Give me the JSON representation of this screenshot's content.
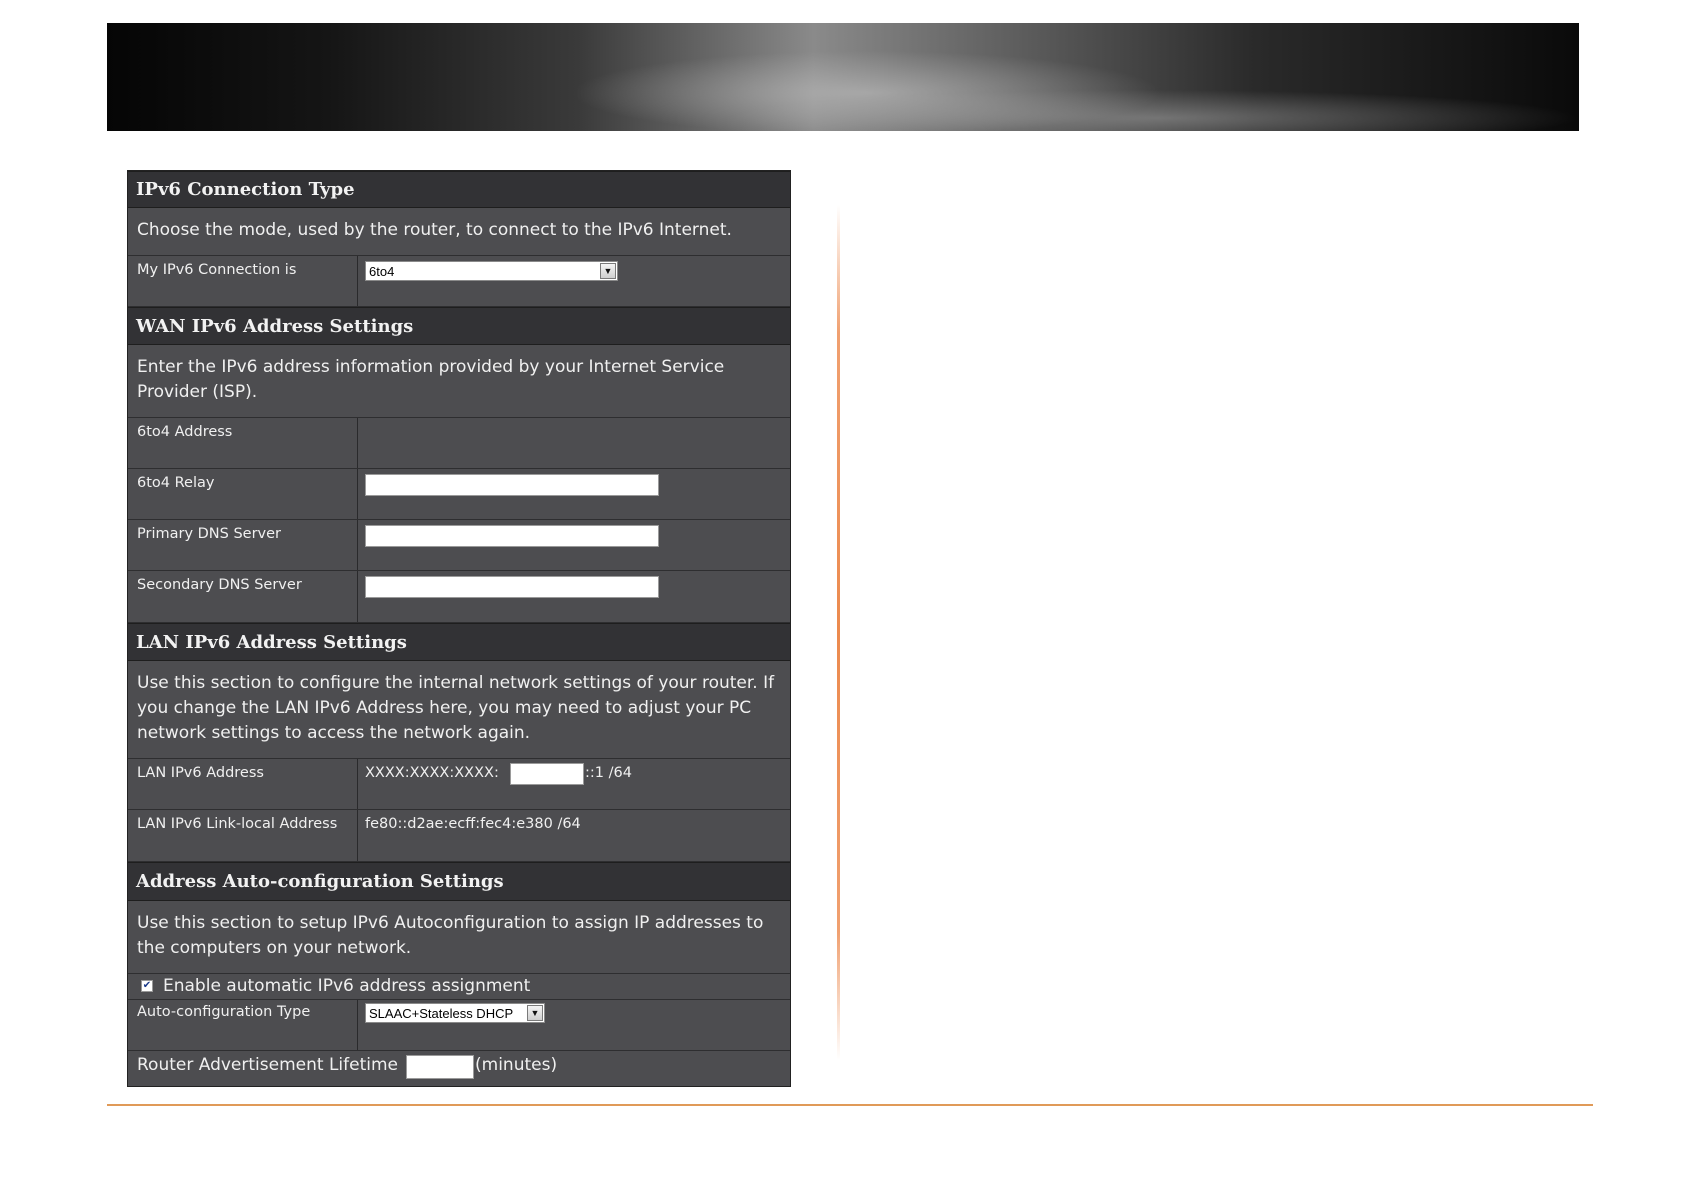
{
  "sections": {
    "connection_type": {
      "title": "IPv6 Connection Type",
      "description": "Choose the mode, used by the router, to connect to the IPv6 Internet.",
      "connection_label": "My IPv6 Connection is",
      "connection_value": "6to4"
    },
    "wan": {
      "title": "WAN IPv6 Address Settings",
      "description": "Enter the IPv6 address information provided by your Internet Service Provider (ISP).",
      "address_label": "6to4 Address",
      "relay_label": "6to4 Relay",
      "primary_dns_label": "Primary DNS Server",
      "secondary_dns_label": "Secondary DNS Server"
    },
    "lan": {
      "title": "LAN IPv6 Address Settings",
      "description": "Use this section to configure the internal network settings of your router. If you change the LAN IPv6 Address here, you may need to adjust your PC network settings to access the network again.",
      "address_label": "LAN IPv6 Address",
      "address_prefix": "XXXX:XXXX:XXXX:",
      "address_suffix": "::1 /64",
      "link_local_label": "LAN IPv6 Link-local Address",
      "link_local_value": "fe80::d2ae:ecff:fec4:e380 /64"
    },
    "autoconfig": {
      "title": "Address Auto-configuration Settings",
      "description": "Use this section to setup IPv6 Autoconfiguration to assign IP addresses to the computers on your network.",
      "enable_label": "Enable automatic IPv6 address assignment",
      "enable_checked": true,
      "type_label": "Auto-configuration Type",
      "type_value": "SLAAC+Stateless DHCP",
      "lifetime_label": "Router Advertisement Lifetime",
      "lifetime_unit": "(minutes)"
    }
  }
}
